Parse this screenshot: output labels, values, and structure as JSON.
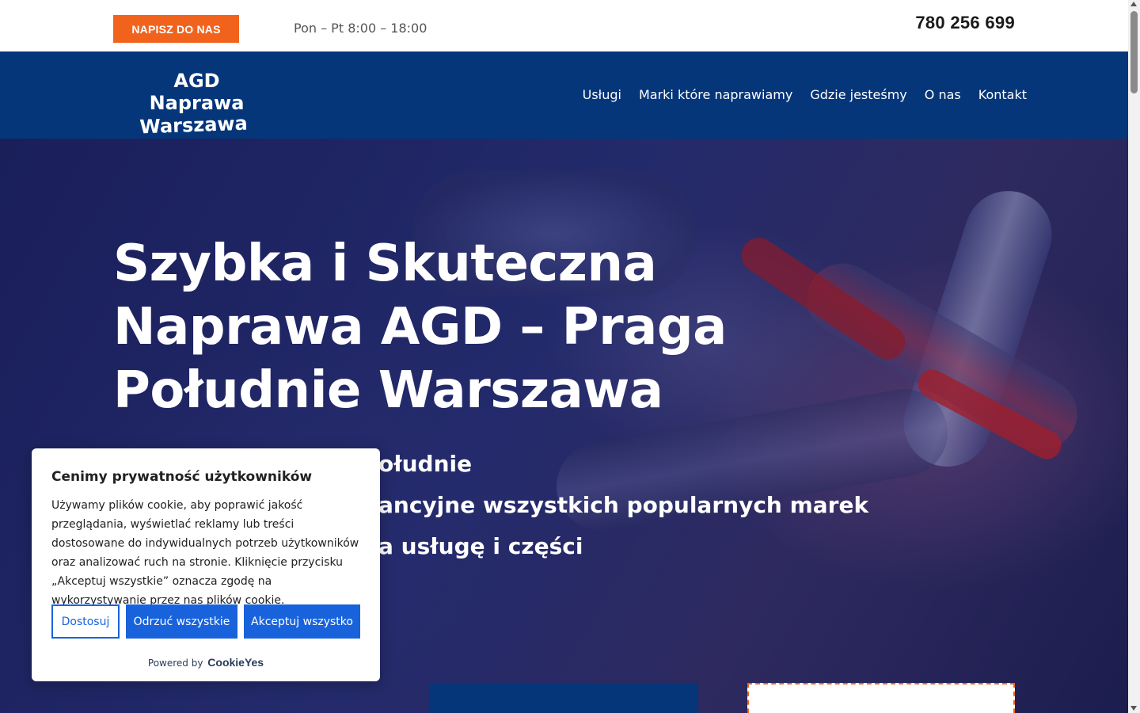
{
  "topbar": {
    "cta_label": "NAPISZ DO NAS",
    "hours": "Pon – Pt 8:00 – 18:00",
    "phone": "780 256 699"
  },
  "logo": {
    "line1": "AGD Naprawa",
    "line2": "Warszawa"
  },
  "nav": {
    "items": [
      "Usługi",
      "Marki które naprawiamy",
      "Gdzie jesteśmy",
      "O nas",
      "Kontakt"
    ]
  },
  "hero": {
    "title_lines": [
      "Szybka i Skuteczna",
      "Naprawa AGD – Praga",
      "Południe Warszawa"
    ],
    "bullets": [
      "ołudnie",
      "ancyjne wszystkich popularnych marek",
      "a usługę i części"
    ]
  },
  "cookie": {
    "title": "Cenimy prywatność użytkowników",
    "text": "Używamy plików cookie, aby poprawić jakość przeglądania, wyświetlać reklamy lub treści dostosowane do indywidualnych potrzeb użytkowników oraz analizować ruch na stronie. Kliknięcie przycisku „Akceptuj wszystkie” oznacza zgodę na wykorzystywanie przez nas plików cookie.",
    "btn_customize": "Dostosuj",
    "btn_reject": "Odrzuć wszystkie",
    "btn_accept": "Akceptuj wszystko",
    "powered_by": "Powered by",
    "brand": "CookieYes"
  },
  "colors": {
    "accent": "#f1631d",
    "nav": "#05367a",
    "cookie_btn": "#1863dc"
  }
}
